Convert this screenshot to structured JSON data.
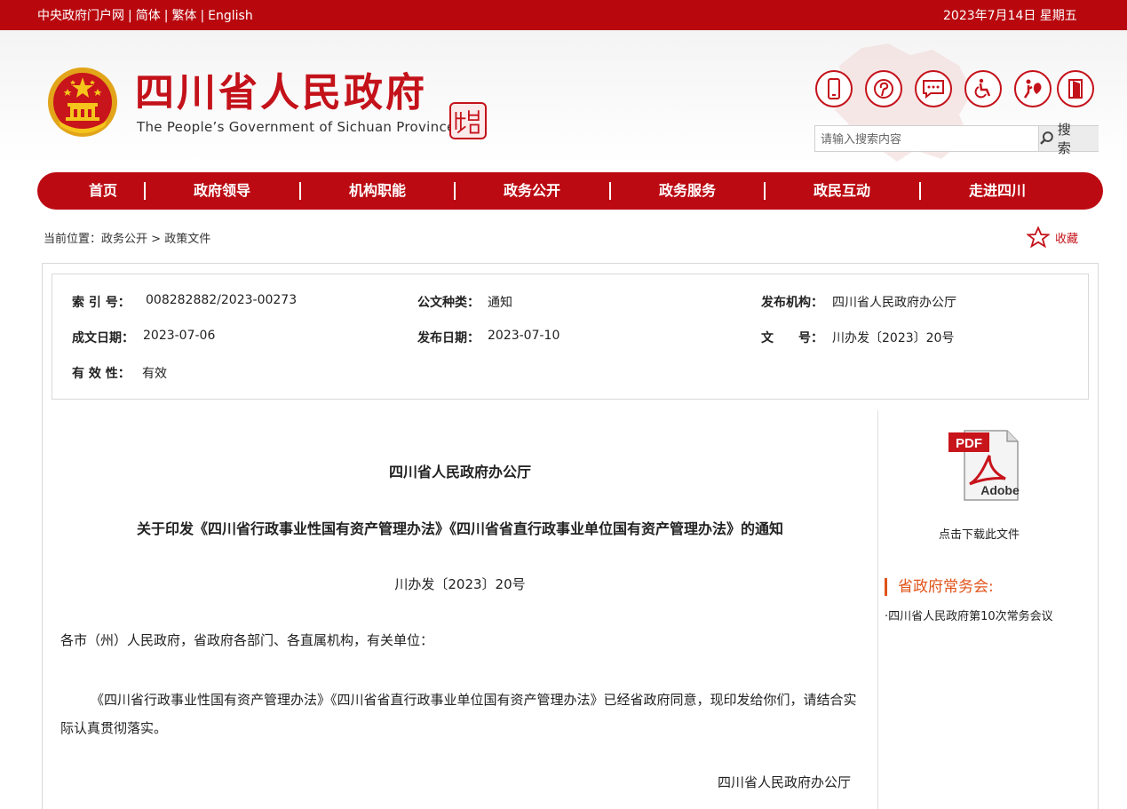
{
  "topbar": {
    "links": [
      "中央政府门户网",
      "简体",
      "繁体",
      "English"
    ],
    "separator": "|",
    "date": "2023年7月14日 星期五"
  },
  "header": {
    "title": "四川省人民政府",
    "subtitle": "The People’s Government of Sichuan Province",
    "icons": [
      "mobile-icon",
      "pinterest-icon",
      "chat-icon",
      "accessibility-icon",
      "elderly-care-icon",
      "exit-icon"
    ],
    "brand_color": "#c4121a"
  },
  "search": {
    "placeholder": "请输入搜索内容",
    "button_label": "搜 索"
  },
  "nav": {
    "items": [
      "首页",
      "政府领导",
      "机构职能",
      "政务公开",
      "政务服务",
      "政民互动",
      "走进四川"
    ],
    "bg_color": "#bc0a12"
  },
  "breadcrumb": {
    "prefix": "当前位置：",
    "items": [
      "政务公开",
      "政策文件"
    ],
    "separator": ">"
  },
  "favorite_label": "收藏",
  "meta": {
    "index_label": "索 引 号：",
    "index_value": "008282882/2023-00273",
    "type_label": "公文种类：",
    "type_value": "通知",
    "publisher_label": "发布机构：",
    "publisher_value": "四川省人民政府办公厅",
    "created_label": "成文日期：",
    "created_value": "2023-07-06",
    "published_label": "发布日期：",
    "published_value": "2023-07-10",
    "docno_label": "文　　号：",
    "docno_value": "川办发〔2023〕20号",
    "validity_label": "有 效 性：",
    "validity_value": "有效"
  },
  "article": {
    "org": "四川省人民政府办公厅",
    "title": "关于印发《四川省行政事业性国有资产管理办法》《四川省省直行政事业单位国有资产管理办法》的通知",
    "number": "川办发〔2023〕20号",
    "salutation": "各市（州）人民政府，省政府各部门、各直属机构，有关单位：",
    "body": "《四川省行政事业性国有资产管理办法》《四川省省直行政事业单位国有资产管理办法》已经省政府同意，现印发给你们，请结合实际认真贯彻落实。",
    "signature": "四川省人民政府办公厅"
  },
  "sidebar": {
    "pdf_label": "PDF",
    "adobe_label": "Adobe",
    "download_label": "点击下载此文件",
    "section_title": "省政府常务会:",
    "links": [
      "·四川省人民政府第10次常务会议"
    ],
    "accent_color": "#e0531a"
  }
}
